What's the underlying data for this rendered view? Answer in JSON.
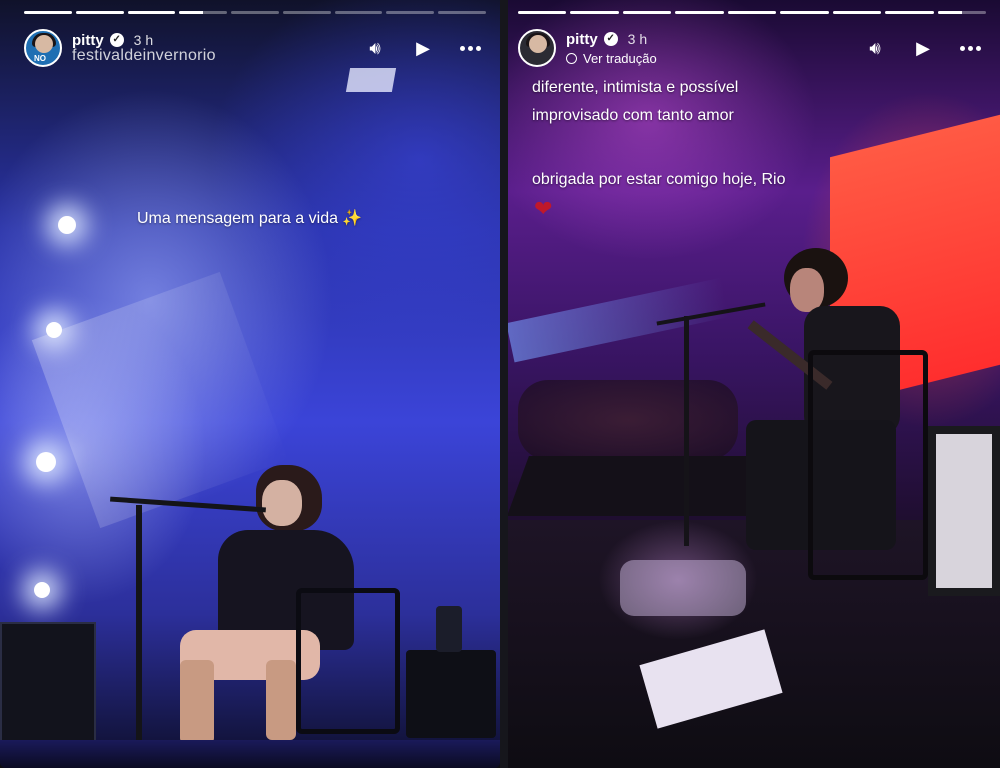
{
  "left_story": {
    "progress": [
      1,
      1,
      1,
      0.5,
      0,
      0,
      0,
      0,
      0
    ],
    "username": "pitty",
    "time": "3 h",
    "location_tag": "festivaldeinvernorio",
    "caption": "Uma mensagem para a vida ✨",
    "avatar_badge": "NO",
    "icons": [
      "volume-icon",
      "play-icon",
      "more-icon",
      "verified-icon"
    ]
  },
  "right_story": {
    "progress": [
      1,
      1,
      1,
      1,
      1,
      1,
      1,
      1,
      0.5
    ],
    "username": "pitty",
    "time": "3 h",
    "translate_label": "Ver tradução",
    "caption_lines": [
      "diferente, intimista e possível",
      "improvisado com tanto amor"
    ],
    "caption_line3": "obrigada por estar comigo hoje, Rio",
    "heart": "❤",
    "icons": [
      "volume-icon",
      "play-icon",
      "more-icon",
      "verified-icon",
      "globe-icon"
    ]
  },
  "colors": {
    "left_stage": "#3b44d8",
    "right_stage": "#5a1e8c",
    "right_screen": "#ff4a3c",
    "heart": "#c0182a"
  }
}
